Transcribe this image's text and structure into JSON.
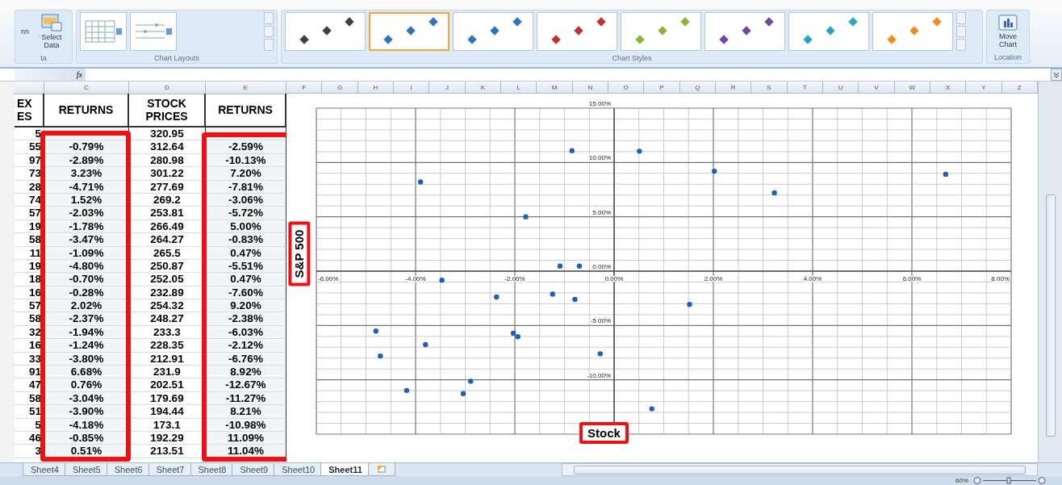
{
  "ribbon": {
    "data_group": {
      "label": "ta",
      "partial_button": "nn",
      "select_data": "Select Data"
    },
    "layouts_group": {
      "label": "Chart Layouts",
      "thumbnails": [
        {
          "kind": "columns"
        },
        {
          "kind": "lines"
        }
      ]
    },
    "styles_group": {
      "label": "Chart Styles",
      "styles": [
        {
          "color": "#404040",
          "selected": false
        },
        {
          "color": "#2e75b6",
          "selected": true
        },
        {
          "color": "#2e75b6",
          "selected": false
        },
        {
          "color": "#c0302e",
          "selected": false
        },
        {
          "color": "#8cb43a",
          "selected": false
        },
        {
          "color": "#7048a0",
          "selected": false
        },
        {
          "color": "#2aa6c4",
          "selected": false
        },
        {
          "color": "#f08a24",
          "selected": false
        }
      ]
    },
    "location_group": {
      "label": "Location",
      "move_chart": "Move Chart"
    }
  },
  "formula_bar": {
    "function_label": "fx"
  },
  "table": {
    "columns": [
      {
        "header": [
          "EX",
          "ES"
        ]
      },
      {
        "letter": "C",
        "header": [
          "RETURNS"
        ]
      },
      {
        "letter": "D",
        "header": [
          "STOCK",
          "PRICES"
        ]
      },
      {
        "letter": "E",
        "header": [
          "RETURNS"
        ]
      }
    ],
    "rows": [
      {
        "b": "5",
        "d": "320.95"
      },
      {
        "b": "55",
        "c": "-0.79%",
        "d": "312.64",
        "e": "-2.59%"
      },
      {
        "b": "97",
        "c": "-2.89%",
        "d": "280.98",
        "e": "-10.13%"
      },
      {
        "b": "73",
        "c": "3.23%",
        "d": "301.22",
        "e": "7.20%"
      },
      {
        "b": "28",
        "c": "-4.71%",
        "d": "277.69",
        "e": "-7.81%"
      },
      {
        "b": "74",
        "c": "1.52%",
        "d": "269.2",
        "e": "-3.06%"
      },
      {
        "b": "57",
        "c": "-2.03%",
        "d": "253.81",
        "e": "-5.72%"
      },
      {
        "b": "19",
        "c": "-1.78%",
        "d": "266.49",
        "e": "5.00%"
      },
      {
        "b": "58",
        "c": "-3.47%",
        "d": "264.27",
        "e": "-0.83%"
      },
      {
        "b": "11",
        "c": "-1.09%",
        "d": "265.5",
        "e": "0.47%"
      },
      {
        "b": "19",
        "c": "-4.80%",
        "d": "250.87",
        "e": "-5.51%"
      },
      {
        "b": "18",
        "c": "-0.70%",
        "d": "252.05",
        "e": "0.47%"
      },
      {
        "b": "16",
        "c": "-0.28%",
        "d": "232.89",
        "e": "-7.60%"
      },
      {
        "b": "57",
        "c": "2.02%",
        "d": "254.32",
        "e": "9.20%"
      },
      {
        "b": "58",
        "c": "-2.37%",
        "d": "248.27",
        "e": "-2.38%"
      },
      {
        "b": "32",
        "c": "-1.94%",
        "d": "233.3",
        "e": "-6.03%"
      },
      {
        "b": "16",
        "c": "-1.24%",
        "d": "228.35",
        "e": "-2.12%"
      },
      {
        "b": "33",
        "c": "-3.80%",
        "d": "212.91",
        "e": "-6.76%"
      },
      {
        "b": "91",
        "c": "6.68%",
        "d": "231.9",
        "e": "8.92%"
      },
      {
        "b": "47",
        "c": "0.76%",
        "d": "202.51",
        "e": "-12.67%"
      },
      {
        "b": "58",
        "c": "-3.04%",
        "d": "179.69",
        "e": "-11.27%"
      },
      {
        "b": "51",
        "c": "-3.90%",
        "d": "194.44",
        "e": "8.21%"
      },
      {
        "b": "5",
        "c": "-4.18%",
        "d": "173.1",
        "e": "-10.98%"
      },
      {
        "b": "46",
        "c": "-0.85%",
        "d": "192.29",
        "e": "11.09%"
      },
      {
        "b": "3",
        "c": "0.51%",
        "d": "213.51",
        "e": "11.04%"
      }
    ]
  },
  "sheet_columns": [
    "F",
    "G",
    "H",
    "I",
    "J",
    "K",
    "L",
    "M",
    "N",
    "O",
    "P",
    "Q",
    "R",
    "S",
    "T",
    "U",
    "V",
    "W",
    "X",
    "Y",
    "Z"
  ],
  "chart": {
    "chart_data": {
      "type": "scatter",
      "grid": true,
      "xlabel": "Stock",
      "ylabel": "S&P 500",
      "xlim": [
        -6,
        8
      ],
      "ylim": [
        -15,
        15
      ],
      "xticks": [
        {
          "value": -6,
          "label": "-6.00%"
        },
        {
          "value": -4,
          "label": "-4.00%"
        },
        {
          "value": -2,
          "label": "-2.00%"
        },
        {
          "value": 0,
          "label": "0.00%"
        },
        {
          "value": 2,
          "label": "2.00%"
        },
        {
          "value": 4,
          "label": "4.00%"
        },
        {
          "value": 6,
          "label": "6.00%"
        },
        {
          "value": 8,
          "label": "8.00%"
        }
      ],
      "yticks": [
        {
          "value": 15,
          "label": "15.00%"
        },
        {
          "value": 10,
          "label": "10.00%"
        },
        {
          "value": 5,
          "label": "5.00%"
        },
        {
          "value": 0,
          "label": "0.00%"
        },
        {
          "value": -5,
          "label": "-5.00%"
        },
        {
          "value": -10,
          "label": "-10.00%"
        }
      ],
      "x": [
        -0.79,
        -2.89,
        3.23,
        -4.71,
        1.52,
        -2.03,
        -1.78,
        -3.47,
        -1.09,
        -4.8,
        -0.7,
        -0.28,
        2.02,
        -2.37,
        -1.94,
        -1.24,
        -3.8,
        6.68,
        0.76,
        -3.04,
        -3.9,
        -4.18,
        -0.85,
        0.51
      ],
      "series": [
        {
          "color": "#1f5fb8",
          "values": [
            -2.59,
            -10.13,
            7.2,
            -7.81,
            -3.06,
            -5.72,
            5.0,
            -0.83,
            0.47,
            -5.51,
            0.47,
            -7.6,
            9.2,
            -2.38,
            -6.03,
            -2.12,
            -6.76,
            8.92,
            -12.67,
            -11.27,
            8.21,
            -10.98,
            11.09,
            11.04
          ]
        }
      ]
    }
  },
  "sheet_tabs": [
    {
      "label": "Sheet4",
      "selected": false
    },
    {
      "label": "Sheet5",
      "selected": false
    },
    {
      "label": "Sheet6",
      "selected": false
    },
    {
      "label": "Sheet7",
      "selected": false
    },
    {
      "label": "Sheet8",
      "selected": false
    },
    {
      "label": "Sheet9",
      "selected": false
    },
    {
      "label": "Sheet10",
      "selected": false
    },
    {
      "label": "Sheet11",
      "selected": true
    }
  ],
  "status_bar": {
    "zoom": "60%"
  }
}
